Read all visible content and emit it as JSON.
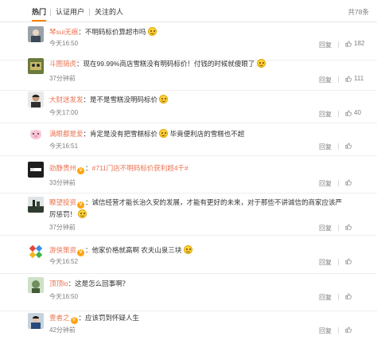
{
  "tabs": [
    {
      "label": "热门",
      "active": true
    },
    {
      "label": "认证用户",
      "active": false
    },
    {
      "label": "关注的人",
      "active": false
    }
  ],
  "total_label": "共78条",
  "actions": {
    "reply": "回复"
  },
  "comments": [
    {
      "user": "琴sui无痕",
      "verified": false,
      "text": "不明码标价算超市吗",
      "time": "今天16:50",
      "likes": "182",
      "emoji_after": true
    },
    {
      "user": "斗图骑虎",
      "verified": false,
      "text": "现在99.99%商店雪糕没有明码标价！付钱的时候就傻眼了",
      "time": "37分钟前",
      "likes": "111",
      "emoji_after": true
    },
    {
      "user": "大财迷发发",
      "verified": false,
      "text": "是不是雪糕没明码标价",
      "time": "今天17:00",
      "likes": "40",
      "emoji_after": true
    },
    {
      "user": "满眼都是爱",
      "verified": false,
      "text": "肯定是没有把雪糕标价",
      "text2": "毕竟便利店的雪糕也不超",
      "time": "今天16:51",
      "likes": "",
      "emoji_after": false
    },
    {
      "user": "劲静贵州",
      "verified": true,
      "hashtag": "#711门店不明码标价获利超4千#",
      "time": "33分钟前",
      "likes": "",
      "emoji_after": false
    },
    {
      "user": "瞭望投资",
      "verified": true,
      "text": "诚信经营才能长治久安的发展，才能有更好的未来，对于那些不讲诚信的商家应该严厉惩罚！",
      "time": "37分钟前",
      "likes": "",
      "emoji_after": true
    },
    {
      "user": "游侠策资",
      "verified": true,
      "text": "他家价格就高啊 农夫山泉三块",
      "time": "今天16:52",
      "likes": "",
      "emoji_after": true
    },
    {
      "user": "顶顶lo",
      "verified": false,
      "text": "这是怎么回事啊？",
      "time": "今天16:50",
      "likes": "",
      "emoji_after": false
    },
    {
      "user": "壹者之",
      "verified": true,
      "text": "应该罚到怀疑人生",
      "time": "42分钟前",
      "likes": "",
      "emoji_after": false
    }
  ],
  "colors": {
    "accent": "#ff8200",
    "username": "#eb7350",
    "verified": "#ffa30f"
  }
}
